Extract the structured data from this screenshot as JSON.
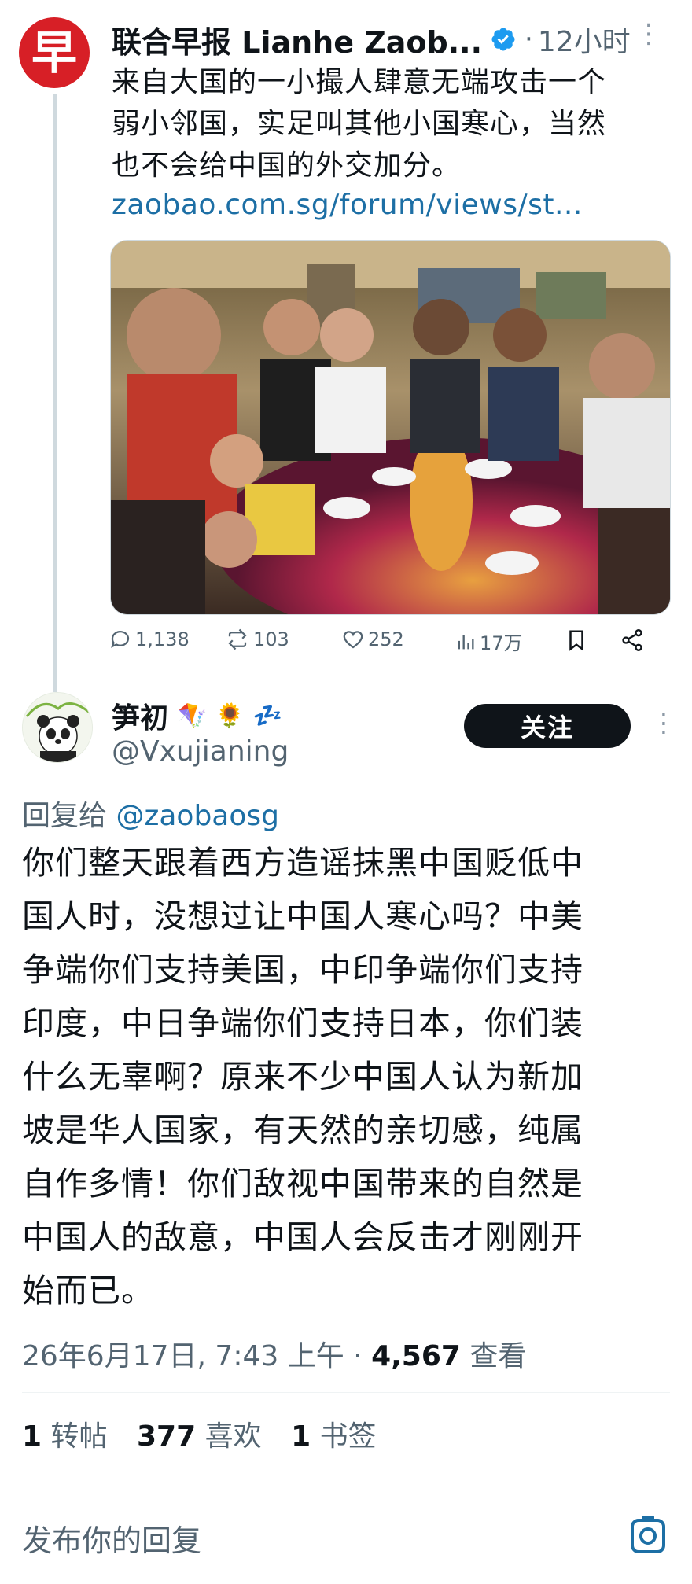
{
  "parent_tweet": {
    "account_name": "联合早报 Lianhe Zaob...",
    "avatar_glyph": "早",
    "avatar_color": "#d71f26",
    "time_sep": "·",
    "time": "12小时",
    "text_lines": [
      "来自大国的一小撮人肆意无端攻击一个",
      "弱小邻国，实足叫其他小国寒心，当然",
      "也不会给中国的外交加分。"
    ],
    "link": "zaobao.com.sg/forum/views/st...",
    "actions": {
      "replies": "1,138",
      "retweets": "103",
      "likes": "252",
      "views": "17万"
    }
  },
  "reply_tweet": {
    "display_name": "笋初",
    "emojis": "🪁 🌻 💤",
    "handle": "@Vxujianing",
    "follow_label": "关注",
    "reply_to_prefix": "回复给",
    "reply_to_handle": "@zaobaosg",
    "text_lines": [
      "你们整天跟着西方造谣抹黑中国贬低中",
      "国人时，没想过让中国人寒心吗？中美",
      "争端你们支持美国，中印争端你们支持",
      "印度，中日争端你们支持日本，你们装",
      "什么无辜啊？原来不少中国人认为新加",
      "坡是华人国家，有天然的亲切感，纯属",
      "自作多情！你们敌视中国带来的自然是",
      "中国人的敌意，中国人会反击才刚刚开",
      "始而已。"
    ],
    "date": "26年6月17日, 7:43 上午",
    "meta_sep": "·",
    "views_count": "4,567",
    "views_label": "查看",
    "stats": {
      "reposts_count": "1",
      "reposts_label": "转帖",
      "likes_count": "377",
      "likes_label": "喜欢",
      "bookmarks_count": "1",
      "bookmarks_label": "书签"
    }
  },
  "compose": {
    "placeholder": "发布你的回复"
  },
  "colors": {
    "link_blue": "#1d6fa5",
    "secondary_text": "#536471",
    "verified_blue": "#1d9bf0"
  }
}
